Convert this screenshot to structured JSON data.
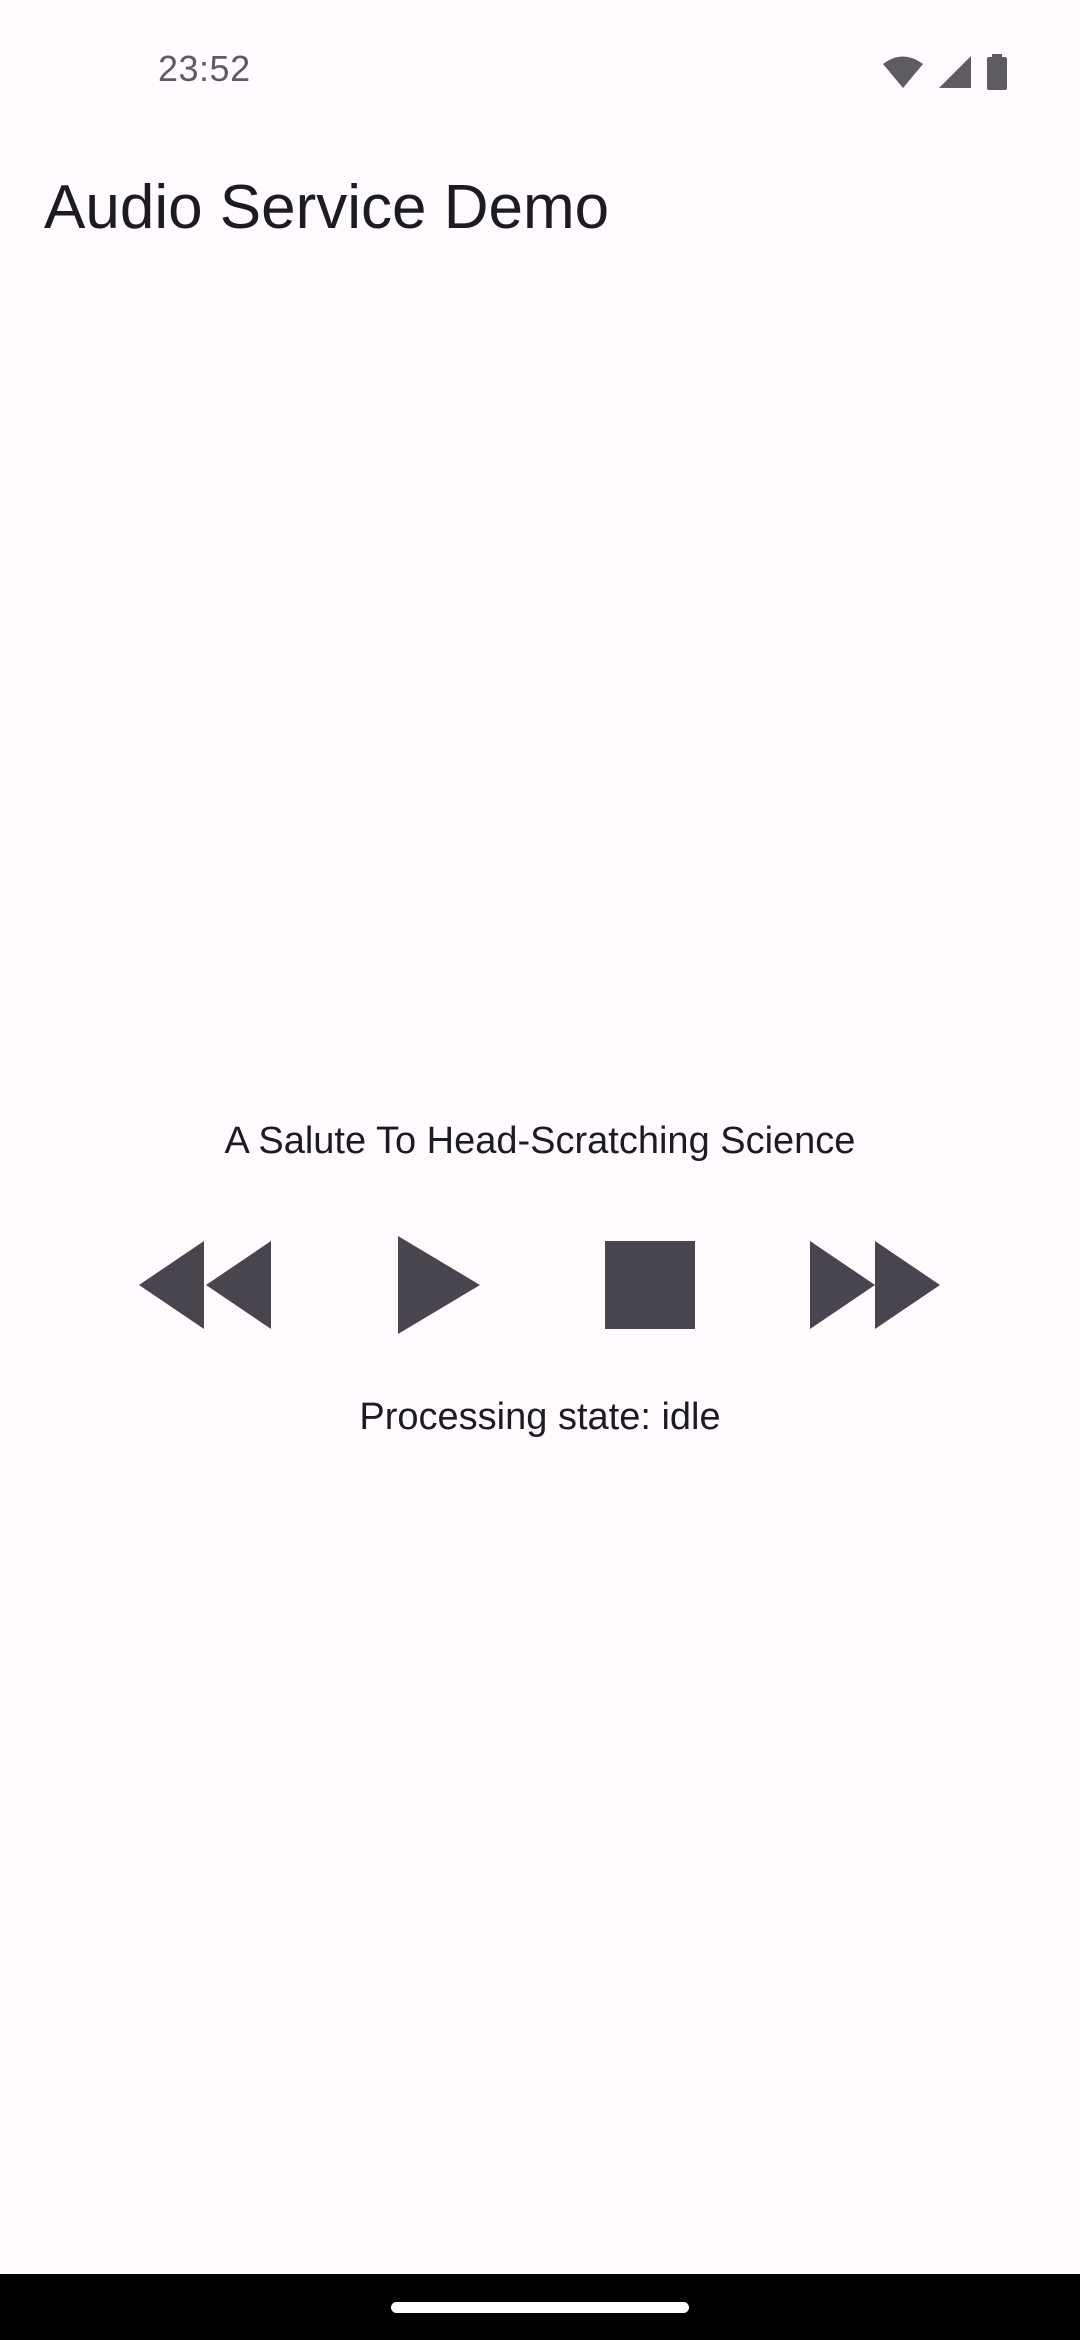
{
  "status_bar": {
    "time": "23:52",
    "icons": [
      "wifi-icon",
      "cellular-signal-icon",
      "battery-icon"
    ]
  },
  "app": {
    "title": "Audio Service Demo"
  },
  "player": {
    "track_title": "A Salute To Head-Scratching Science",
    "controls": [
      {
        "name": "rewind",
        "icon": "rewind-icon"
      },
      {
        "name": "play",
        "icon": "play-icon"
      },
      {
        "name": "stop",
        "icon": "stop-icon"
      },
      {
        "name": "fast-forward",
        "icon": "fast-forward-icon"
      }
    ],
    "processing_state": "Processing state: idle"
  },
  "colors": {
    "background": "#fffbfe",
    "icon": "#49454f",
    "text": "#1c1b1f",
    "status_text": "#5f5b62",
    "nav_bar": "#000000"
  }
}
